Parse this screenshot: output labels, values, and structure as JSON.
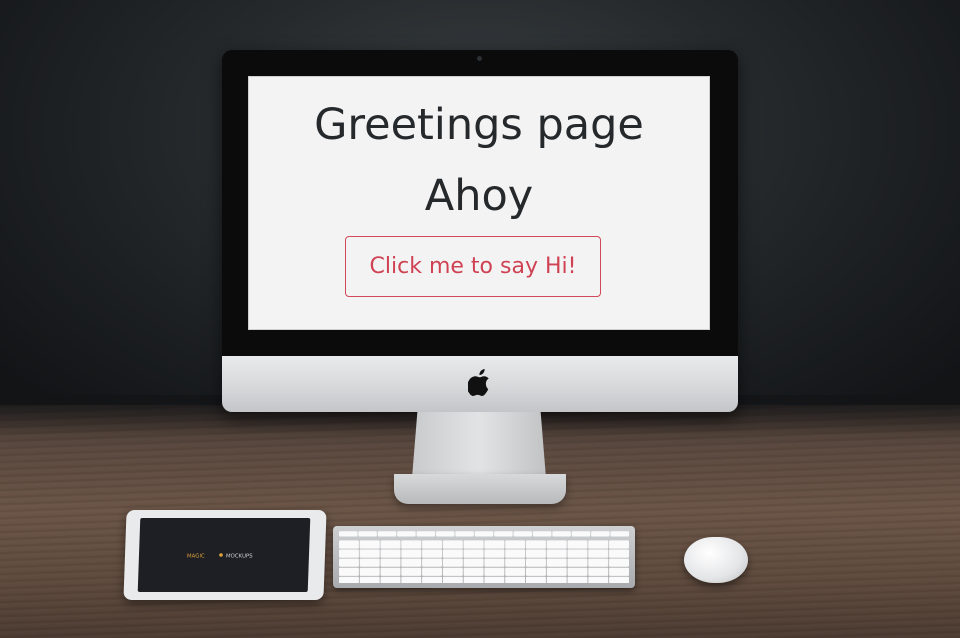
{
  "app": {
    "title": "Greetings page",
    "subtitle": "Ahoy",
    "say_hi_button_label": "Click me to say Hi!"
  },
  "tablet": {
    "brand_text": "MAGIC MOCKUPS"
  },
  "colors": {
    "screen_background": "#f4f3f3",
    "heading_text": "#26292c",
    "button_outline": "#d0495a",
    "button_text": "#cf4254"
  },
  "icons": {
    "computer_logo": "apple-logo-icon"
  }
}
